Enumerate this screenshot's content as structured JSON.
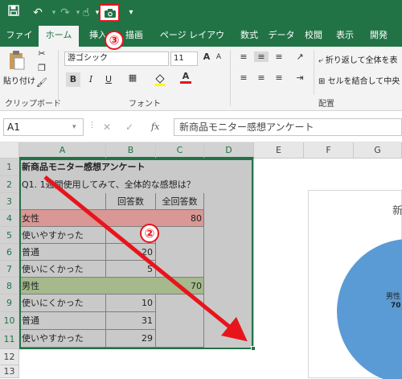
{
  "qat": {
    "icons": [
      "save-icon",
      "undo-icon",
      "redo-icon",
      "touch-mode-icon",
      "camera-icon",
      "customize-icon"
    ]
  },
  "tabs": [
    {
      "label": "ファイル"
    },
    {
      "label": "ホーム"
    },
    {
      "label": "挿入"
    },
    {
      "label": "描画"
    },
    {
      "label": "ページ レイアウト"
    },
    {
      "label": "数式"
    },
    {
      "label": "データ"
    },
    {
      "label": "校閲"
    },
    {
      "label": "表示"
    },
    {
      "label": "開発"
    }
  ],
  "ribbon": {
    "clipboard": {
      "paste_label": "貼り付け",
      "group_label": "クリップボード"
    },
    "font": {
      "font_name": "游ゴシック",
      "font_size": "11",
      "grow": "A",
      "shrink": "A",
      "bold": "B",
      "italic": "I",
      "underline": "U",
      "font_color": "A",
      "group_label": "フォント"
    },
    "alignment": {
      "wrap_text": "折り返して全体を表",
      "merge_center": "セルを結合して中央",
      "group_label": "配置"
    }
  },
  "formula_bar": {
    "name_box": "A1",
    "fx": "fx",
    "content": "新商品モニター感想アンケート"
  },
  "columns": [
    "A",
    "B",
    "C",
    "D",
    "E",
    "F",
    "G"
  ],
  "rows": [
    "1",
    "2",
    "3",
    "4",
    "5",
    "6",
    "7",
    "8",
    "9",
    "10",
    "11",
    "12",
    "13"
  ],
  "sheet": {
    "title": "新商品モニター感想アンケート",
    "question": "Q1. 1週間使用してみて、全体的な感想は？",
    "header_count": "回答数",
    "header_total": "全回答数",
    "female": {
      "label": "女性",
      "total": "80"
    },
    "female_rows": [
      {
        "label": "使いやすかった",
        "value": ""
      },
      {
        "label": "普通",
        "value": "20"
      },
      {
        "label": "使いにくかった",
        "value": "5"
      }
    ],
    "male": {
      "label": "男性",
      "total": "70"
    },
    "male_rows": [
      {
        "label": "使いにくかった",
        "value": "10"
      },
      {
        "label": "普通",
        "value": "31"
      },
      {
        "label": "使いやすかった",
        "value": "29"
      }
    ]
  },
  "chart": {
    "title_partial": "新",
    "label_male": "男性",
    "label_value": "70"
  },
  "annotations": {
    "badge_2": "②",
    "badge_3": "③",
    "arrow_color": "#e8141c"
  },
  "colors": {
    "excel_green": "#217346",
    "female_fill": "#d99795",
    "male_fill": "#a5b98c",
    "selection_gray": "#c9c9c9",
    "pie_blue": "#5b9bd5"
  }
}
